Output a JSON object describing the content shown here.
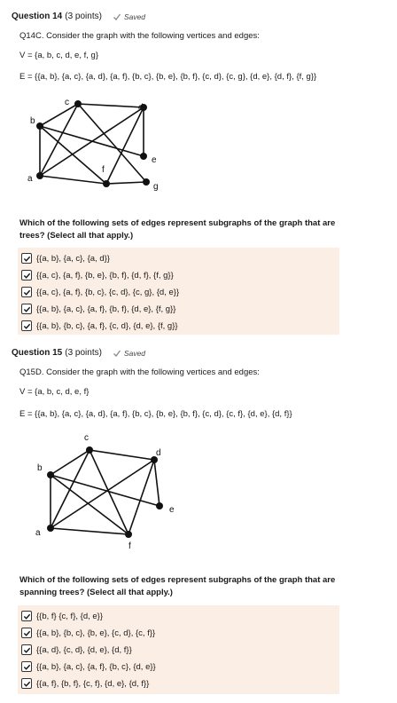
{
  "q14": {
    "title": "Question 14",
    "points": "(3 points)",
    "status": "Saved",
    "prompt": "Q14C. Consider the graph with the following vertices and edges:",
    "vertices": "V = {a, b, c, d, e, f, g}",
    "edges": "E = {{a, b}, {a, c}, {a, d}, {a, f}, {b, c}, {b, e}, {b, f}, {c, d}, {c, g}, {d, e}, {d, f}, {f, g}}",
    "question_line1": "Which of the following sets of edges represent subgraphs of the graph that are",
    "question_line2": "trees? (Select all that apply.)",
    "graph_labels": [
      "a",
      "b",
      "c",
      "d",
      "e",
      "f",
      "g"
    ],
    "options": [
      {
        "label": "{{a, b}, {a, c}, {a, d}}",
        "checked": true
      },
      {
        "label": "{{a, c}, {a, f}, {b, e}, {b, f}, {d, f}, {f, g}}",
        "checked": true
      },
      {
        "label": "{{a, c}, {a, f}, {b, c}, {c, d}, {c, g}, {d, e}}",
        "checked": true
      },
      {
        "label": "{{a, b}, {a, c}, {a, f}, {b, f}, {d, e}, {f, g}}",
        "checked": true
      },
      {
        "label": "{{a, b}, {b, c}, {a, f}, {c, d}, {d, e}, {f, g}}",
        "checked": true
      }
    ]
  },
  "q15": {
    "title": "Question 15",
    "points": "(3 points)",
    "status": "Saved",
    "prompt": "Q15D. Consider the graph with the following vertices and edges:",
    "vertices": "V = {a, b, c, d, e, f}",
    "edges": "E = {{a, b}, {a, c}, {a, d}, {a, f}, {b, c}, {b, e}, {b, f}, {c, d}, {c, f}, {d, e}, {d, f}}",
    "question_line1": "Which of the following sets of edges represent subgraphs of the graph that are",
    "question_line2": "spanning trees? (Select all that apply.)",
    "graph_labels": [
      "a",
      "b",
      "c",
      "d",
      "e",
      "f"
    ],
    "options": [
      {
        "label": "{{b, f} {c, f}, {d, e}}",
        "checked": true
      },
      {
        "label": "{{a, b}, {b, c}, {b, e}, {c, d}, {c, f}}",
        "checked": true
      },
      {
        "label": "{{a, d}, {c, d}, {d, e}, {d, f}}",
        "checked": true
      },
      {
        "label": "{{a, b}, {a, c}, {a, f}, {b, c}, {d, e}}",
        "checked": true
      },
      {
        "label": "{{a, f}, {b, f}, {c, f}, {d, e}, {d, f}}",
        "checked": true
      }
    ]
  }
}
